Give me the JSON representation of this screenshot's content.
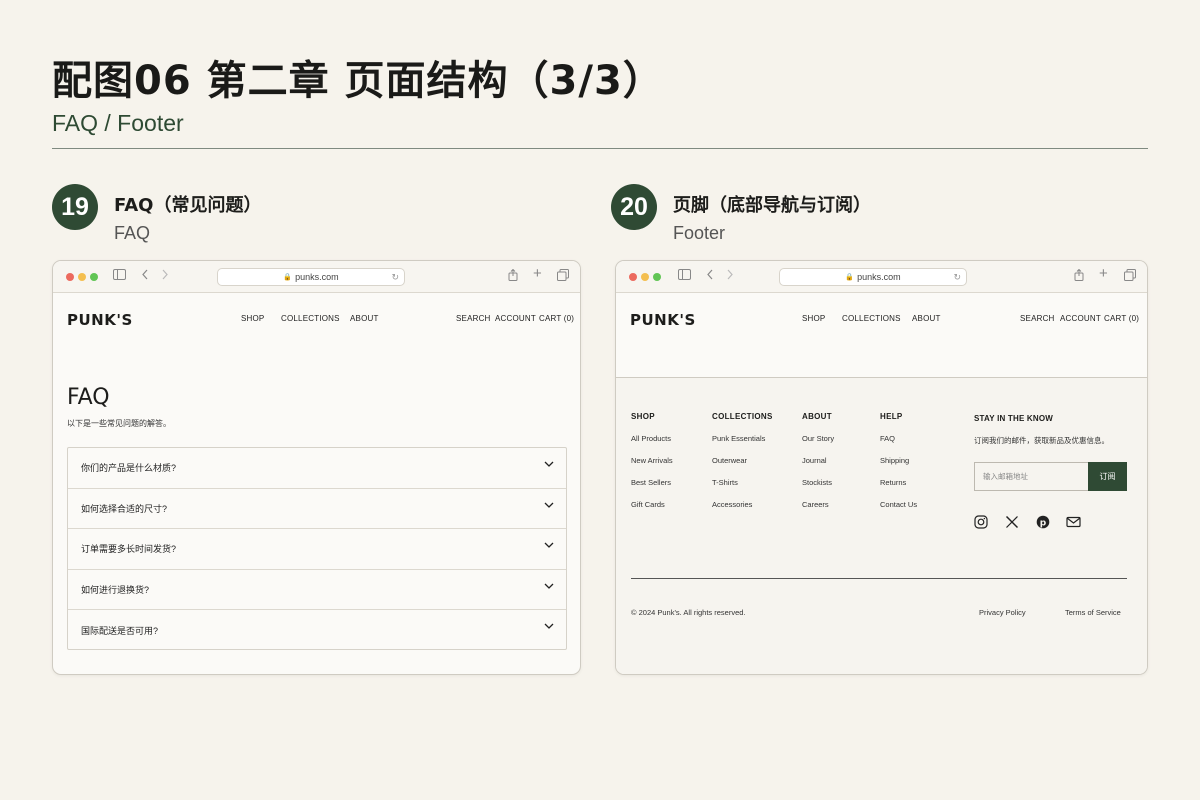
{
  "page": {
    "title": "配图06 第二章 页面结构（3/3）",
    "subtitle": "FAQ / Footer"
  },
  "sections": [
    {
      "number": "19",
      "title_cn": "FAQ（常见问题）",
      "title_en": "FAQ"
    },
    {
      "number": "20",
      "title_cn": "页脚（底部导航与订阅）",
      "title_en": "Footer"
    }
  ],
  "browser": {
    "url": "punks.com",
    "icons": [
      "sidebar-icon",
      "back-icon",
      "forward-icon",
      "lock-icon",
      "reload-icon",
      "share-icon",
      "new-tab-icon",
      "tabs-icon"
    ]
  },
  "site": {
    "logo": "PUNK'S",
    "nav": [
      "SHOP",
      "COLLECTIONS",
      "ABOUT"
    ],
    "utility": [
      "SEARCH",
      "ACCOUNT",
      "CART (0)"
    ]
  },
  "faq": {
    "title": "FAQ",
    "intro": "以下是一些常见问题的解答。",
    "questions": [
      "你们的产品是什么材质?",
      "如何选择合适的尺寸?",
      "订单需要多长时间发货?",
      "如何进行退换货?",
      "国际配送是否可用?"
    ]
  },
  "footer": {
    "columns": [
      {
        "heading": "SHOP",
        "links": [
          "All Products",
          "New Arrivals",
          "Best Sellers",
          "Gift Cards"
        ]
      },
      {
        "heading": "COLLECTIONS",
        "links": [
          "Punk Essentials",
          "Outerwear",
          "T-Shirts",
          "Accessories"
        ]
      },
      {
        "heading": "ABOUT",
        "links": [
          "Our Story",
          "Journal",
          "Stockists",
          "Careers"
        ]
      },
      {
        "heading": "HELP",
        "links": [
          "FAQ",
          "Shipping",
          "Returns",
          "Contact Us"
        ]
      }
    ],
    "newsletter": {
      "heading": "STAY IN THE KNOW",
      "text": "订阅我们的邮件，获取新品及优惠信息。",
      "placeholder": "输入邮箱地址",
      "button": "订阅"
    },
    "social": [
      "instagram-icon",
      "x-icon",
      "pinterest-icon",
      "mail-icon"
    ],
    "copyright": "© 2024 Punk's. All rights reserved.",
    "legal": [
      "Privacy Policy",
      "Terms of Service"
    ]
  },
  "colors": {
    "background": "#f6f3ec",
    "accent": "#2f4a34",
    "text": "#1d1d1b"
  }
}
